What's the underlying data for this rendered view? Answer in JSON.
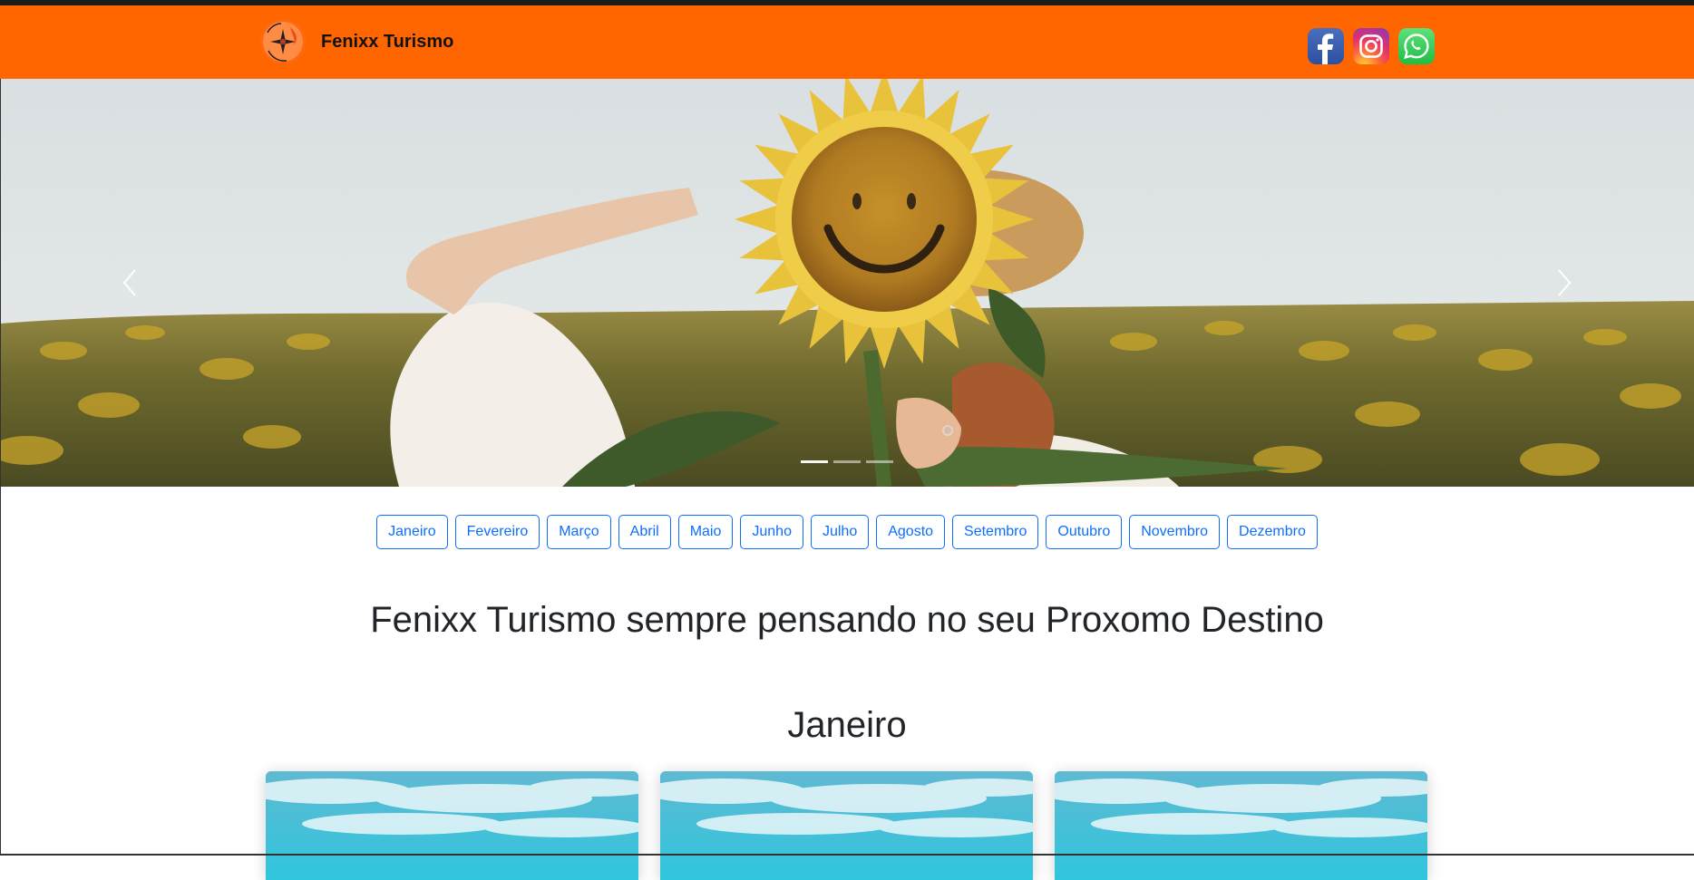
{
  "header": {
    "brand_name": "Fenixx Turismo",
    "logo_text": "FENIXX TURISMO",
    "background_color": "#ff6600",
    "social": [
      {
        "name": "facebook",
        "icon": "facebook-icon",
        "color": "#3b5998"
      },
      {
        "name": "instagram",
        "icon": "instagram-icon",
        "color": "#d6249f"
      },
      {
        "name": "whatsapp",
        "icon": "whatsapp-icon",
        "color": "#25d366"
      }
    ]
  },
  "carousel": {
    "slide_count": 3,
    "active_slide": 1,
    "prev_icon": "chevron-left-icon",
    "next_icon": "chevron-right-icon",
    "image": "woman holding sunflower over face in sunflower field"
  },
  "months": [
    "Janeiro",
    "Fevereiro",
    "Março",
    "Abril",
    "Maio",
    "Junho",
    "Julho",
    "Agosto",
    "Setembro",
    "Outubro",
    "Novembro",
    "Dezembro"
  ],
  "headline": "Fenixx Turismo sempre pensando no seu Proxomo Destino",
  "section": {
    "title": "Janeiro",
    "card_count": 3,
    "card_image": "blue sky with clouds"
  },
  "colors": {
    "accent": "#0d6efd",
    "text": "#212529"
  }
}
